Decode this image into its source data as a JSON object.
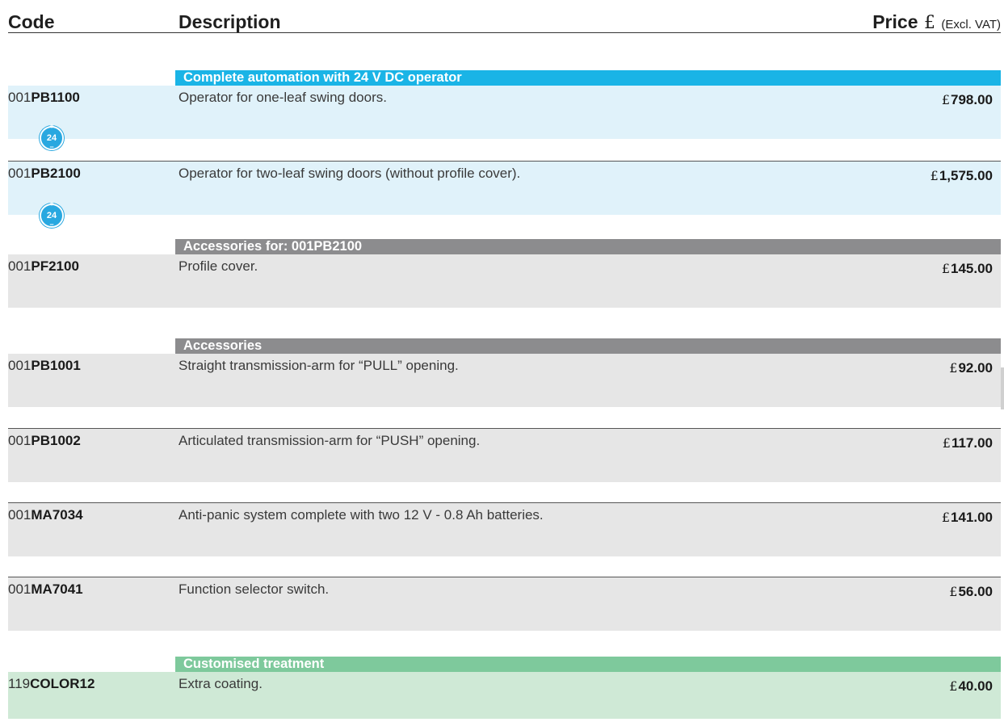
{
  "header": {
    "code": "Code",
    "description": "Description",
    "price": "Price",
    "currency": "£",
    "vat_note": "(Excl. VAT)"
  },
  "colors": {
    "blue_band": "#1ab4e6",
    "blue_row": "#e0f2fa",
    "grey_band": "#8c8c8e",
    "grey_row": "#e6e6e6",
    "green_band": "#7ec99c",
    "green_row": "#cfe9d6"
  },
  "sections": [
    {
      "label": "Complete automation with 24 V DC operator",
      "color": "blue"
    },
    {
      "label": "Accessories for: 001PB2100",
      "color": "grey"
    },
    {
      "label": "Accessories",
      "color": "grey"
    },
    {
      "label": "Customised treatment",
      "color": "green"
    }
  ],
  "badge": {
    "value": "24",
    "plus": "+",
    "minus": "−",
    "icon": "24v-dc-badge-icon"
  },
  "rows": [
    {
      "code_prefix": "001",
      "code_bold": "PB1100",
      "description": "Operator for one-leaf swing doors.",
      "currency": "£",
      "price": "798.00"
    },
    {
      "code_prefix": "001",
      "code_bold": "PB2100",
      "description": "Operator for two-leaf swing doors (without profile cover).",
      "currency": "£",
      "price": "1,575.00"
    },
    {
      "code_prefix": "001",
      "code_bold": "PF2100",
      "description": "Profile cover.",
      "currency": "£",
      "price": "145.00"
    },
    {
      "code_prefix": "001",
      "code_bold": "PB1001",
      "description": "Straight transmission-arm for “PULL” opening.",
      "currency": "£",
      "price": "92.00"
    },
    {
      "code_prefix": "001",
      "code_bold": "PB1002",
      "description": "Articulated transmission-arm for “PUSH” opening.",
      "currency": "£",
      "price": "117.00"
    },
    {
      "code_prefix": "001",
      "code_bold": "MA7034",
      "description": "Anti-panic system complete with two 12 V - 0.8 Ah batteries.",
      "currency": "£",
      "price": "141.00"
    },
    {
      "code_prefix": "001",
      "code_bold": "MA7041",
      "description": "Function selector switch.",
      "currency": "£",
      "price": "56.00"
    },
    {
      "code_prefix": "119",
      "code_bold": "COLOR12",
      "description": "Extra coating.",
      "currency": "£",
      "price": "40.00"
    }
  ]
}
